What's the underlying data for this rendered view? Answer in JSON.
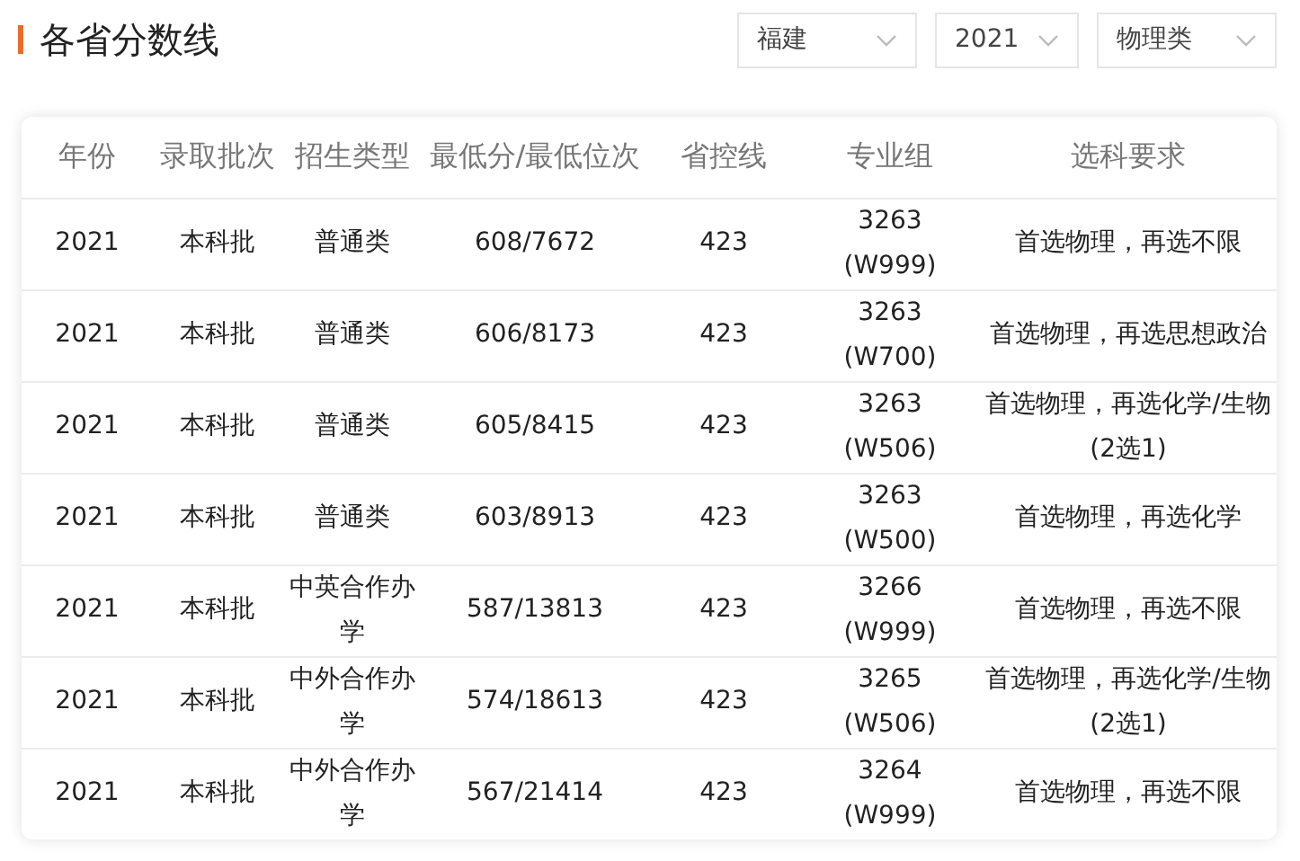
{
  "title": "各省分数线",
  "filters": [
    {
      "value": "福建"
    },
    {
      "value": "2021"
    },
    {
      "value": "物理类"
    }
  ],
  "table": {
    "columns": [
      "年份",
      "录取批次",
      "招生类型",
      "最低分/最低位次",
      "省控线",
      "专业组",
      "选科要求"
    ],
    "rows": [
      [
        "2021",
        "本科批",
        "普通类",
        "608/7672",
        "423",
        "3263 (W999)",
        "首选物理，再选不限"
      ],
      [
        "2021",
        "本科批",
        "普通类",
        "606/8173",
        "423",
        "3263 (W700)",
        "首选物理，再选思想政治"
      ],
      [
        "2021",
        "本科批",
        "普通类",
        "605/8415",
        "423",
        "3263 (W506)",
        "首选物理，再选化学/生物(2选1)"
      ],
      [
        "2021",
        "本科批",
        "普通类",
        "603/8913",
        "423",
        "3263 (W500)",
        "首选物理，再选化学"
      ],
      [
        "2021",
        "本科批",
        "中英合作办学",
        "587/13813",
        "423",
        "3266 (W999)",
        "首选物理，再选不限"
      ],
      [
        "2021",
        "本科批",
        "中外合作办学",
        "574/18613",
        "423",
        "3265 (W506)",
        "首选物理，再选化学/生物(2选1)"
      ],
      [
        "2021",
        "本科批",
        "中外合作办学",
        "567/21414",
        "423",
        "3264 (W999)",
        "首选物理，再选不限"
      ]
    ]
  }
}
